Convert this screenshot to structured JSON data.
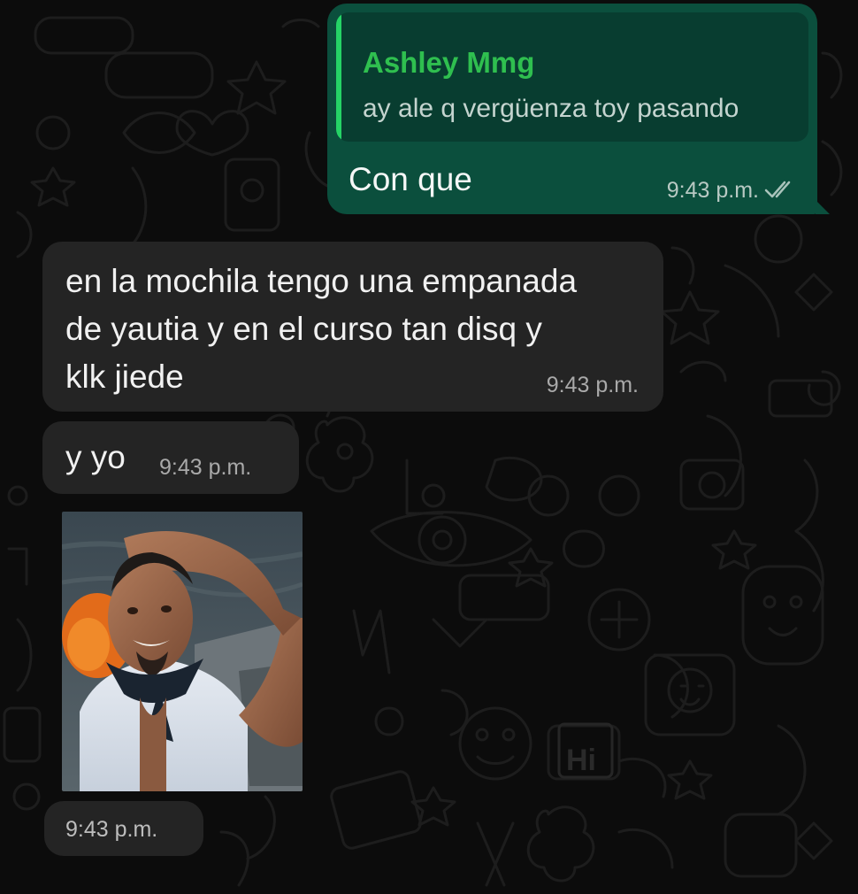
{
  "colors": {
    "background": "#0c0c0c",
    "outgoing_bubble": "#0b4f3d",
    "quote_background": "#083d30",
    "quote_accent": "#25d366",
    "incoming_bubble": "#242424"
  },
  "messages": {
    "outgoing": {
      "quoted": {
        "author": "Ashley Mmg",
        "text": "ay ale q vergüenza toy pasando"
      },
      "text": "Con que",
      "time": "9:43 p.m.",
      "status_icon": "double-check-read-icon"
    },
    "incoming": [
      {
        "lines": [
          "en la mochila tengo una empanada",
          "de yautia y en el curso tan disq y",
          "klk jiede"
        ],
        "time": "9:43 p.m."
      },
      {
        "text": "y yo",
        "time": "9:43 p.m."
      },
      {
        "type": "gif-image",
        "subject": "smiling man on boat with hand on head",
        "time": "9:43 p.m."
      }
    ]
  }
}
